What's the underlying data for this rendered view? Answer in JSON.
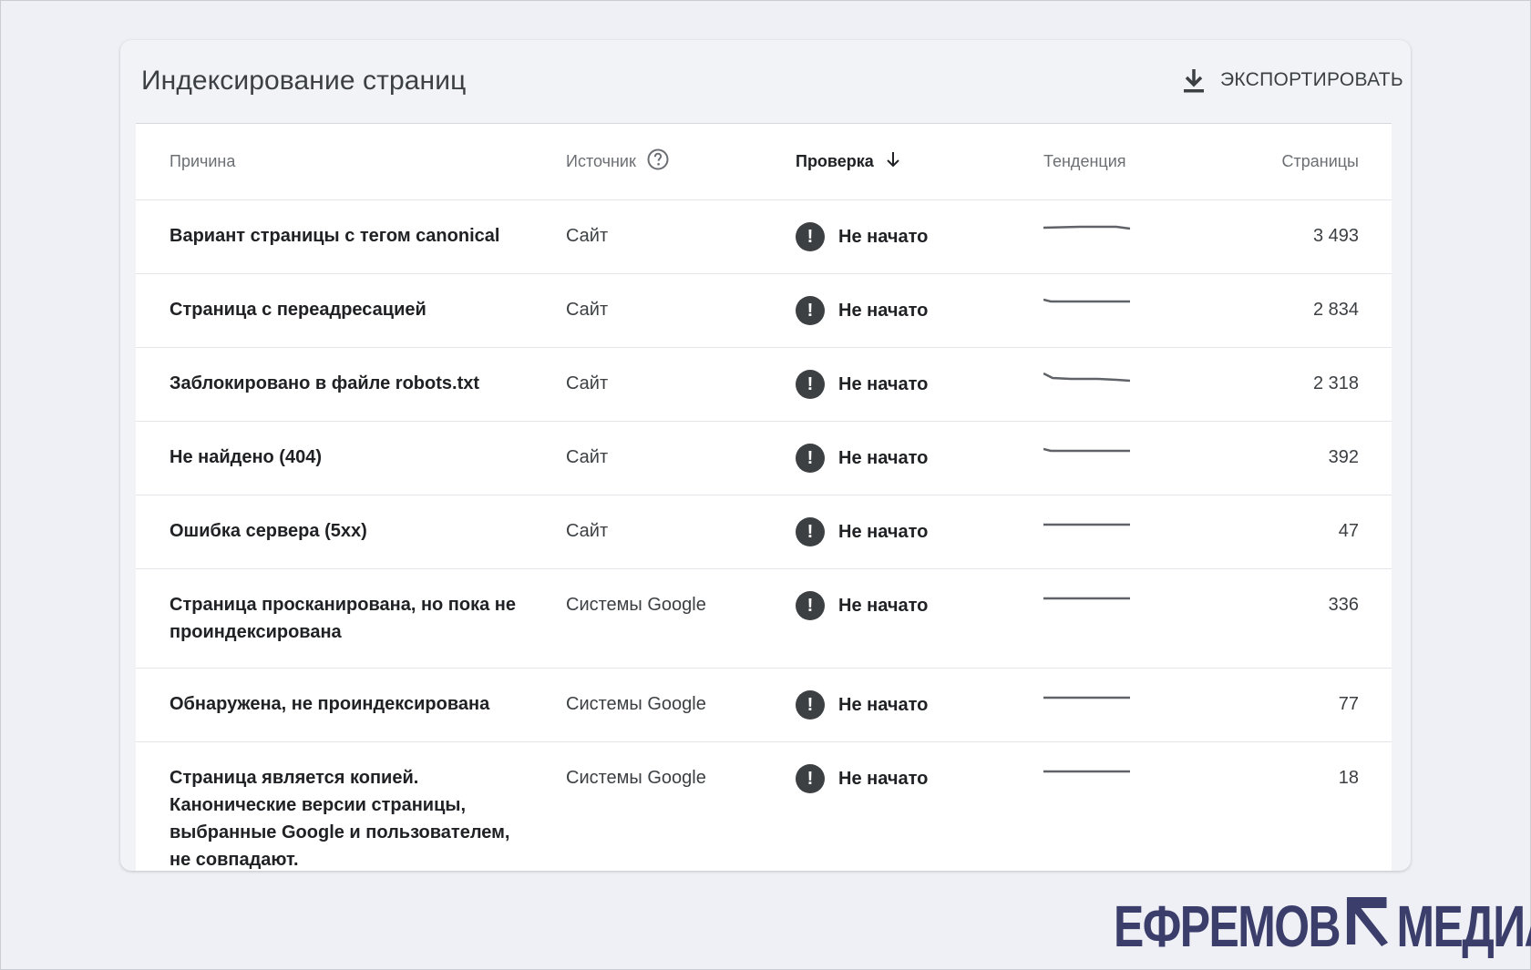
{
  "header": {
    "title": "Индексирование страниц",
    "export_label": "ЭКСПОРТИРОВАТЬ"
  },
  "table": {
    "columns": {
      "reason": "Причина",
      "source": "Источник",
      "check": "Проверка",
      "trend": "Тенденция",
      "pages": "Страницы"
    },
    "rows": [
      {
        "reason": "Вариант страницы с тегом canonical",
        "source": "Сайт",
        "status": "Не начато",
        "pages": "3 493"
      },
      {
        "reason": "Страница с переадресацией",
        "source": "Сайт",
        "status": "Не начато",
        "pages": "2 834"
      },
      {
        "reason": "Заблокировано в файле robots.txt",
        "source": "Сайт",
        "status": "Не начато",
        "pages": "2 318"
      },
      {
        "reason": "Не найдено (404)",
        "source": "Сайт",
        "status": "Не начато",
        "pages": "392"
      },
      {
        "reason": "Ошибка сервера (5xx)",
        "source": "Сайт",
        "status": "Не начато",
        "pages": "47"
      },
      {
        "reason": "Страница просканирована, но пока не проиндексирована",
        "source": "Системы Google",
        "status": "Не начато",
        "pages": "336"
      },
      {
        "reason": "Обнаружена, не проиндексирована",
        "source": "Системы Google",
        "status": "Не начато",
        "pages": "77"
      },
      {
        "reason": "Страница является копией. Канонические версии страницы, выбранные Google и пользователем, не совпадают.",
        "source": "Системы Google",
        "status": "Не начато",
        "pages": "18"
      }
    ]
  },
  "logo": {
    "left": "ЕФРЕМОВ",
    "right": "МЕДИА",
    "color": "#3b3d6b"
  },
  "colors": {
    "background": "#eef0f5",
    "status_icon": "#3c4043",
    "trend_line": "#5f6368"
  },
  "icons": {
    "export": "download-icon",
    "help": "help-circle-icon",
    "sort": "arrow-down-icon",
    "status": "exclamation-circle-icon"
  }
}
